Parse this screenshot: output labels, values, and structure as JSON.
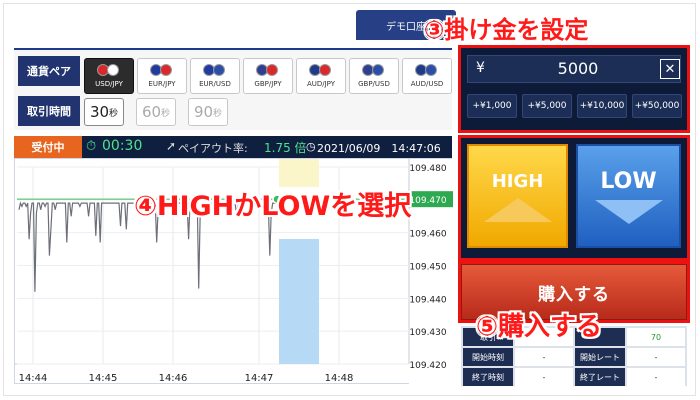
{
  "demo_tab": "デモ口座",
  "pair_panel": {
    "pair_label": "通貨ペア",
    "time_label": "取引時間",
    "pairs": [
      {
        "label": "USD/JPY",
        "active": true,
        "flags": [
          "#d9292b",
          "#ffffff"
        ]
      },
      {
        "label": "EUR/JPY",
        "active": false,
        "flags": [
          "#1f3aa0",
          "#d9292b"
        ]
      },
      {
        "label": "EUR/USD",
        "active": false,
        "flags": [
          "#1f3aa0",
          "#2b4ea8"
        ]
      },
      {
        "label": "GBP/JPY",
        "active": false,
        "flags": [
          "#2e3f8f",
          "#d9292b"
        ]
      },
      {
        "label": "AUD/JPY",
        "active": false,
        "flags": [
          "#1e3a8a",
          "#d9292b"
        ]
      },
      {
        "label": "GBP/USD",
        "active": false,
        "flags": [
          "#2e3f8f",
          "#2b4ea8"
        ]
      },
      {
        "label": "AUD/USD",
        "active": false,
        "flags": [
          "#1e3a8a",
          "#2b4ea8"
        ]
      }
    ],
    "times": [
      {
        "value": "30",
        "unit": "秒",
        "active": true
      },
      {
        "value": "60",
        "unit": "秒",
        "active": false
      },
      {
        "value": "90",
        "unit": "秒",
        "active": false
      }
    ]
  },
  "status": {
    "badge": "受付中",
    "timer": "00:30",
    "payout_label": "ペイアウト率:",
    "payout_value": "1.75 倍",
    "datetime": "2021/06/09　14:47:06"
  },
  "amount": {
    "currency": "¥",
    "value": "5000",
    "clear": "✕",
    "quick": [
      "+¥1,000",
      "+¥5,000",
      "+¥10,000",
      "+¥50,000"
    ]
  },
  "trade": {
    "high": "HIGH",
    "low": "LOW",
    "buy": "購入する"
  },
  "info": {
    "rows": [
      {
        "l1": "取引",
        "v1": "",
        "l2": "",
        "v2": "70"
      },
      {
        "l1": "開始時刻",
        "v1": "-",
        "l2": "開始レート",
        "v2": "-"
      },
      {
        "l1": "終了時刻",
        "v1": "-",
        "l2": "終了レート",
        "v2": "-"
      }
    ]
  },
  "annotations": {
    "step3": "③掛け金を設定",
    "step4": "④HIGHかLOWを選択",
    "step5": "⑤購入する"
  },
  "colors": {
    "accent": "#e11111",
    "navy": "#0d1a38",
    "status_orange": "#e8651f",
    "price_green": "#4ee38e"
  },
  "chart_data": {
    "type": "line",
    "x_ticks": [
      "14:44",
      "14:45",
      "14:46",
      "14:47",
      "14:48"
    ],
    "y_ticks": [
      109.48,
      109.47,
      109.46,
      109.45,
      109.44,
      109.43,
      109.42
    ],
    "y_tick_labels": [
      "109.480",
      "109.470",
      "109.460",
      "109.450",
      "109.440",
      "109.430",
      "109.420"
    ],
    "ylim": [
      109.42,
      109.48
    ],
    "current_price": "109.470",
    "current_value": 109.4702,
    "series": [
      {
        "name": "",
        "values": [
          109.467,
          109.469,
          109.468,
          109.469,
          109.469,
          109.468,
          109.469,
          109.458,
          109.466,
          109.469,
          109.469,
          109.442,
          109.466,
          109.469,
          109.469,
          109.467,
          109.469,
          109.469,
          109.468,
          109.469,
          109.469,
          109.453,
          109.461,
          109.469,
          109.469,
          109.467,
          109.469,
          109.469,
          109.469,
          109.469,
          109.469,
          109.469,
          109.469,
          109.457,
          109.469,
          109.469,
          109.465,
          109.469,
          109.469,
          109.469,
          109.469,
          109.469,
          109.468,
          109.469,
          109.469,
          109.469,
          109.469,
          109.469,
          109.465,
          109.469,
          109.469,
          109.469,
          109.469,
          109.459,
          109.469,
          109.469,
          109.457,
          109.469,
          109.469,
          109.469,
          109.469,
          109.469,
          109.469,
          109.469,
          109.469,
          109.469,
          109.469,
          109.469,
          109.469,
          109.469,
          109.462,
          109.469,
          109.469,
          109.469,
          109.461,
          109.469,
          109.469,
          109.469,
          109.469,
          109.469,
          109.469,
          109.469,
          109.469,
          109.469,
          109.469,
          109.469,
          109.469,
          109.469,
          109.469,
          109.469,
          109.469,
          109.469,
          109.469,
          109.469,
          109.469,
          109.457,
          109.467,
          109.469,
          109.469,
          109.469,
          109.469,
          109.469,
          109.469,
          109.469,
          109.469,
          109.469,
          109.469,
          109.469,
          109.469,
          109.469,
          109.469,
          109.469,
          109.469,
          109.469,
          109.469,
          109.469,
          109.469,
          109.458,
          109.469,
          109.469,
          109.469,
          109.469,
          109.469,
          109.469,
          109.443,
          109.466,
          109.469,
          109.469,
          109.469,
          109.469,
          109.469,
          109.469,
          109.469,
          109.469,
          109.469,
          109.469,
          109.469,
          109.469,
          109.469,
          109.469,
          109.469,
          109.469,
          109.469,
          109.469,
          109.469,
          109.469,
          109.469,
          109.469,
          109.469,
          109.469,
          109.466,
          109.468,
          109.469,
          109.469,
          109.469,
          109.469,
          109.469,
          109.469,
          109.469,
          109.469,
          109.469,
          109.469,
          109.469,
          109.469,
          109.469,
          109.469,
          109.469,
          109.469,
          109.469,
          109.469,
          109.469,
          109.469,
          109.469,
          109.453,
          109.466,
          109.469,
          109.469,
          109.469,
          109.4702
        ]
      }
    ]
  }
}
